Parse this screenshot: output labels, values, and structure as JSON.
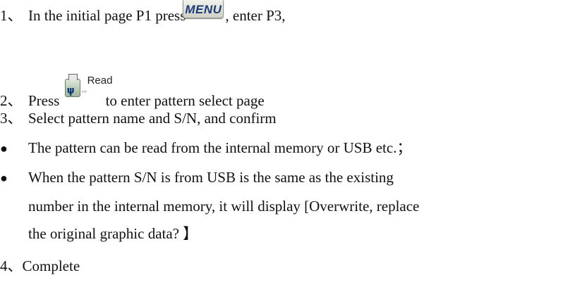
{
  "steps": [
    {
      "num": "1、",
      "before": "In the initial page P1 press",
      "after": ", enter P3,"
    },
    {
      "num": "2、",
      "before": "Press",
      "after": "to enter pattern select page"
    },
    {
      "num": "3、",
      "text": "Select pattern name and S/N, and confirm"
    },
    {
      "num": "4、",
      "text": "Complete"
    }
  ],
  "bullets": [
    {
      "symbol": "●",
      "lines": [
        "The pattern can be read from the internal memory or USB etc.；"
      ]
    },
    {
      "symbol": "●",
      "lines": [
        "When the pattern S/N is from USB is the same as the existing",
        "number in the internal memory, it will display [Overwrite, replace",
        "the original graphic data? 】"
      ]
    }
  ],
  "buttons": {
    "menu": {
      "label": "MENU",
      "icon": "menu-key-icon"
    },
    "read": {
      "label": "Read",
      "icon": "usb-read-icon",
      "arrow": "⇨"
    }
  }
}
